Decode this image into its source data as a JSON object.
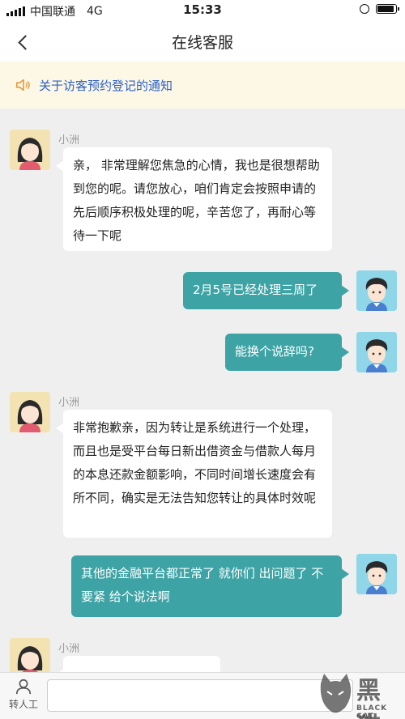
{
  "status_bar": {
    "carrier": "中国联通",
    "network": "4G",
    "time": "15:33"
  },
  "header": {
    "title": "在线客服"
  },
  "notice": {
    "text": "关于访客预约登记的通知",
    "icon": "speaker-icon"
  },
  "messages": [
    {
      "sender": "agent",
      "name": "小洲",
      "text": "亲， 非常理解您焦急的心情，我也是很想帮助到您的呢。请您放心，咱们肯定会按照申请的先后顺序积极处理的呢，辛苦您了，再耐心等待一下呢"
    },
    {
      "sender": "user",
      "text": "2月5号已经处理三周了"
    },
    {
      "sender": "user",
      "text": "能换个说辞吗?"
    },
    {
      "sender": "agent",
      "name": "小洲",
      "text": "非常抱歉亲，因为转让是系统进行一个处理，而且也是受平台每日新出借资金与借款人每月的本息还款金额影响，不同时间增长速度会有所不同，确实是无法告知您转让的具体时效呢"
    },
    {
      "sender": "user",
      "text": "其他的金融平台都正常了 就你们 出问题了 不要紧 给个说法啊"
    },
    {
      "sender": "agent",
      "name": "小洲",
      "text": ""
    }
  ],
  "bottom_bar": {
    "transfer_label": "转人工",
    "input_value": ""
  },
  "watermark": {
    "text_cn": "黑猫",
    "text_en": "BLACK CAT"
  },
  "colors": {
    "user_bubble": "#3da3a5",
    "notice_bg": "#fdf8e6",
    "notice_text": "#2b5fc7"
  }
}
